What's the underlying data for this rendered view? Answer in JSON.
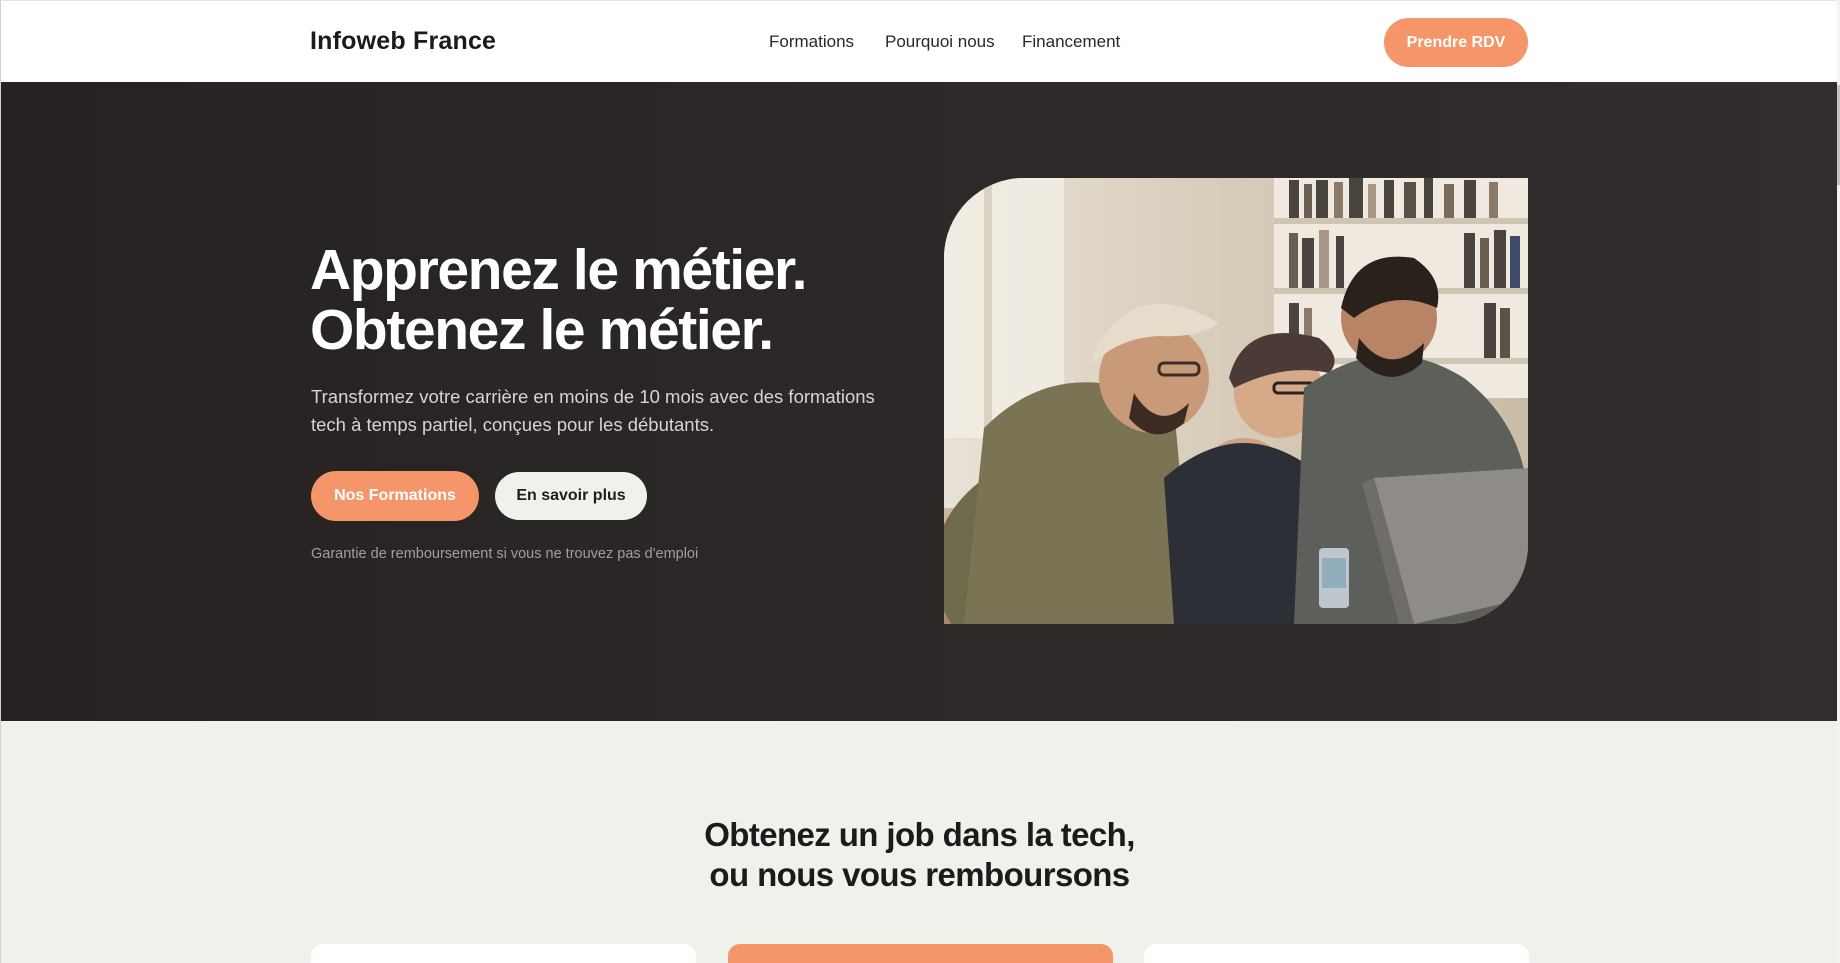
{
  "header": {
    "logo": "Infoweb France",
    "nav": [
      "Formations",
      "Pourquoi nous",
      "Financement"
    ],
    "cta": "Prendre RDV"
  },
  "hero": {
    "title_line1": "Apprenez le métier.",
    "title_line2": "Obtenez le métier.",
    "subtitle_line1": "Transformez votre carrière en moins de 10 mois avec des formations",
    "subtitle_line2": "tech à temps partiel, conçues pour les débutants.",
    "primary_button": "Nos Formations",
    "secondary_button": "En savoir plus",
    "note": "Garantie de remboursement si vous ne trouvez pas d'emploi",
    "image": "photo-of-three-students-laughing-at-laptop"
  },
  "section": {
    "title_line1": "Obtenez un job dans la tech,",
    "title_line2": "ou nous vous remboursons"
  },
  "colors": {
    "accent": "#f4956a",
    "hero_bg": "#2e2929",
    "section_bg": "#eef2ea",
    "light_button": "#eef2ea"
  }
}
